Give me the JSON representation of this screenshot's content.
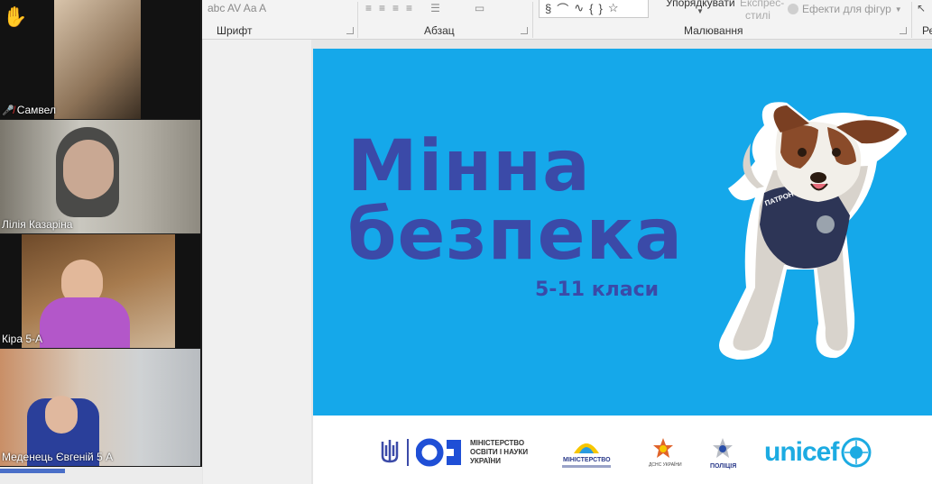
{
  "ribbon": {
    "font_group": "Шрифт",
    "paragraph_group": "Абзац",
    "drawing_group": "Малювання",
    "arrange_label": "Упорядкувати",
    "quick_styles_label_1": "Експрес-",
    "quick_styles_label_2": "стилі",
    "shape_effects_label": "Ефекти для фігур",
    "edit_group_partial": "Ре",
    "font_row": "abc  AV  Aa  A"
  },
  "participants": [
    {
      "name": "Самвел",
      "muted": true
    },
    {
      "name": "Лілія Казаріна",
      "muted": false
    },
    {
      "name": "Кіра 5-А",
      "muted": false,
      "active": true
    },
    {
      "name": "Меденець Євгеній 5 А",
      "muted": false
    }
  ],
  "raised_hand_icon": "✋",
  "slide": {
    "title_line1": "Мінна",
    "title_line2": "безпека",
    "subtitle": "5-11 класи",
    "dog_tag": "ПАТРОН",
    "logos": {
      "ministry_line1": "МІНІСТЕРСТВО",
      "ministry_line2": "ОСВІТИ І НАУКИ",
      "ministry_line3": "УКРАЇНИ",
      "ministry2": "МІНІСТЕРСТВО",
      "dsns": "ДСНС УКРАЇНИ",
      "police": "ПОЛІЦІЯ",
      "unicef": "unicef"
    }
  },
  "colors": {
    "slide_blue": "#15a8ea",
    "title_color": "#3b4aa8",
    "unicef_blue": "#1cabe2"
  }
}
